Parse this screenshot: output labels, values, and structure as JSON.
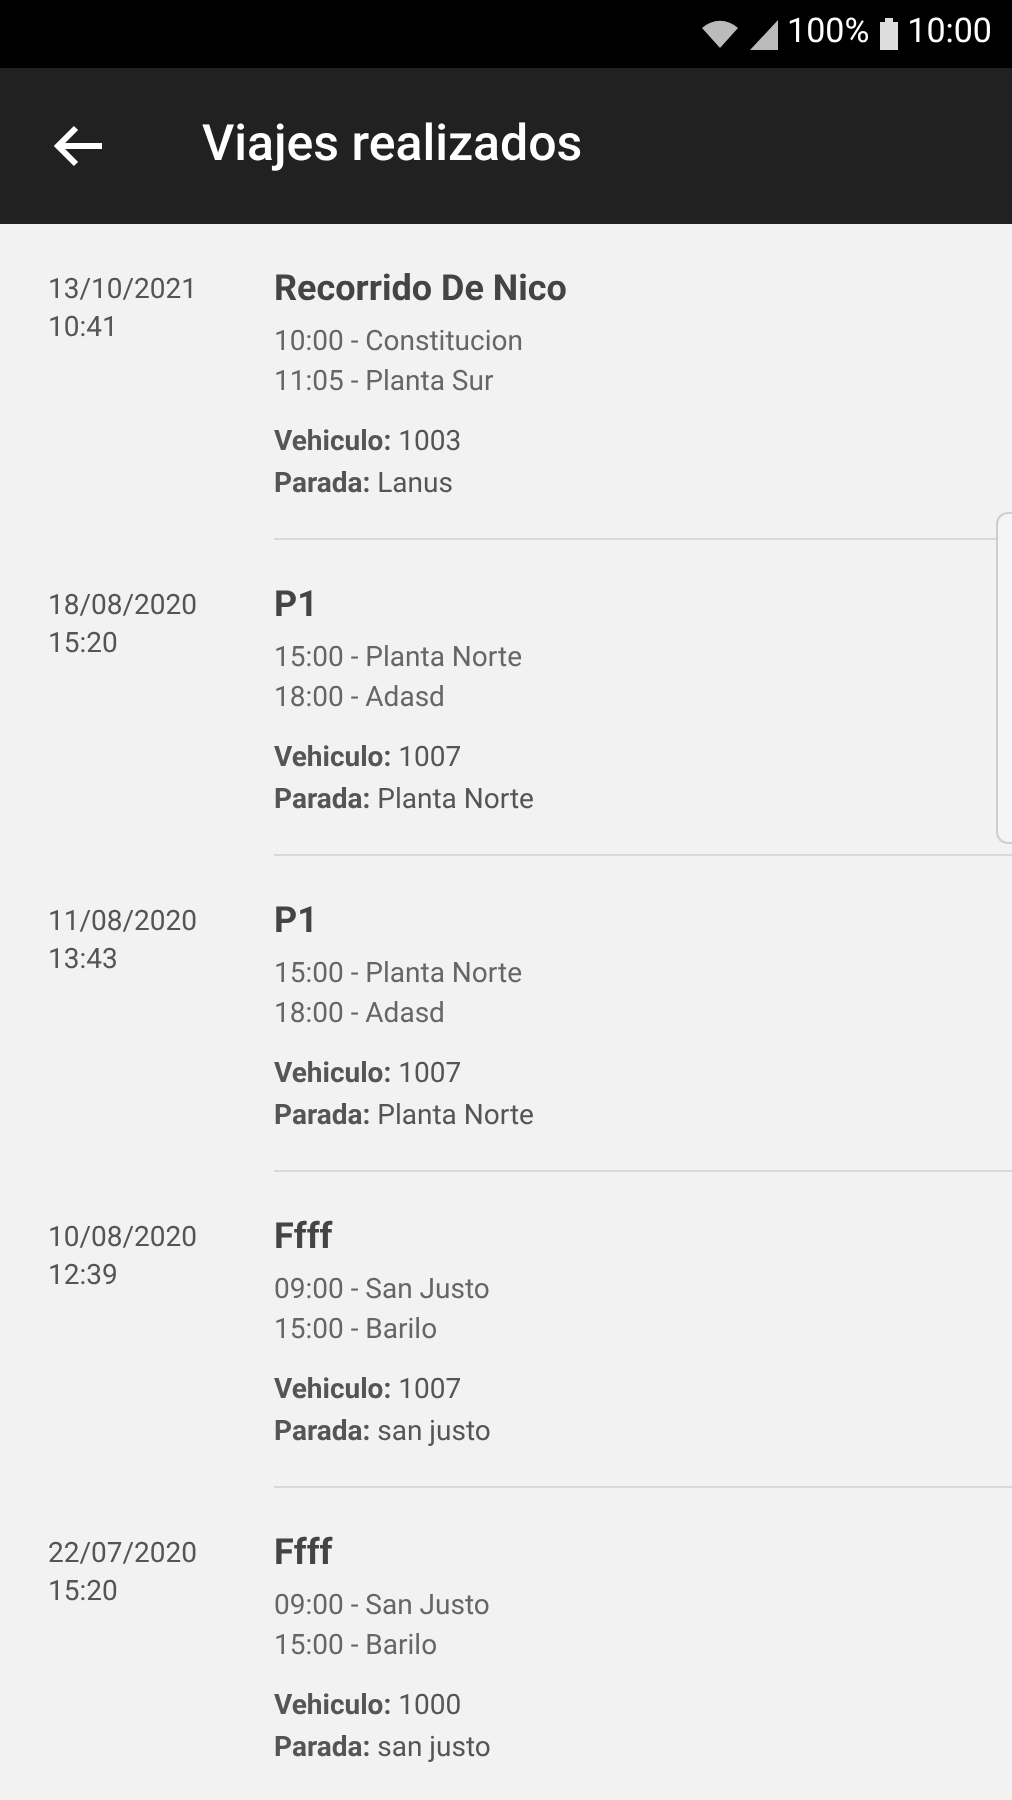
{
  "status_bar": {
    "battery": "100%",
    "time": "10:00"
  },
  "header": {
    "title": "Viajes realizados"
  },
  "trips": [
    {
      "date": "13/10/2021",
      "time": "10:41",
      "title": "Recorrido De Nico",
      "stops": [
        "10:00 - Constitucion",
        "11:05 - Planta Sur"
      ],
      "vehicle": "**Vehiculo:** 1003",
      "stop": "**Parada:** Lanus"
    },
    {
      "date": "18/08/2020",
      "time": "15:20",
      "title": "P1",
      "stops": [
        "15:00 - Planta Norte",
        "18:00 - Adasd"
      ],
      "vehicle": "**Vehiculo:** 1007",
      "stop": "**Parada:** Planta Norte"
    },
    {
      "date": "11/08/2020",
      "time": "13:43",
      "title": "P1",
      "stops": [
        "15:00 - Planta Norte",
        "18:00 - Adasd"
      ],
      "vehicle": "**Vehiculo:** 1007",
      "stop": "**Parada:** Planta Norte"
    },
    {
      "date": "10/08/2020",
      "time": "12:39",
      "title": "Ffff",
      "stops": [
        "09:00 - San Justo",
        "15:00 - Barilo"
      ],
      "vehicle": "**Vehiculo:** 1007",
      "stop": "**Parada:** san justo"
    },
    {
      "date": "22/07/2020",
      "time": "15:20",
      "title": "Ffff",
      "stops": [
        "09:00 - San Justo",
        "15:00 - Barilo"
      ],
      "vehicle": "**Vehiculo:** 1000",
      "stop": "**Parada:** san justo"
    }
  ]
}
